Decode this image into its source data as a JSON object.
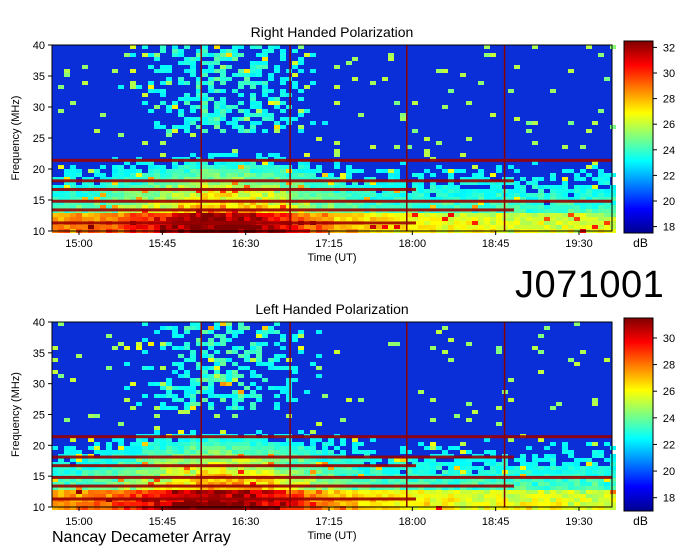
{
  "observation_id": "J071001",
  "footer_text": "Nancay Decameter Array",
  "chart_data": [
    {
      "type": "heatmap",
      "title": "Right Handed Polarization",
      "xlabel": "Time (UT)",
      "ylabel": "Frequency (MHz)",
      "x_ticks": [
        "15:00",
        "15:45",
        "16:30",
        "17:15",
        "18:00",
        "18:45",
        "19:30"
      ],
      "y_ticks": [
        10,
        15,
        20,
        25,
        30,
        35,
        40
      ],
      "ylim": [
        10,
        40
      ],
      "colorbar_unit": "dB",
      "colorbar_ticks": [
        18,
        20,
        22,
        24,
        26,
        28,
        30,
        32
      ],
      "colorbar_range": [
        17.5,
        32.5
      ]
    },
    {
      "type": "heatmap",
      "title": "Left Handed Polarization",
      "xlabel": "Time (UT)",
      "ylabel": "Frequency (MHz)",
      "x_ticks": [
        "15:00",
        "15:45",
        "16:30",
        "17:15",
        "18:00",
        "18:45",
        "19:30"
      ],
      "y_ticks": [
        10,
        15,
        20,
        25,
        30,
        35,
        40
      ],
      "ylim": [
        10,
        40
      ],
      "colorbar_unit": "dB",
      "colorbar_ticks": [
        18,
        20,
        22,
        24,
        26,
        28,
        30
      ],
      "colorbar_range": [
        17,
        31.5
      ]
    }
  ]
}
